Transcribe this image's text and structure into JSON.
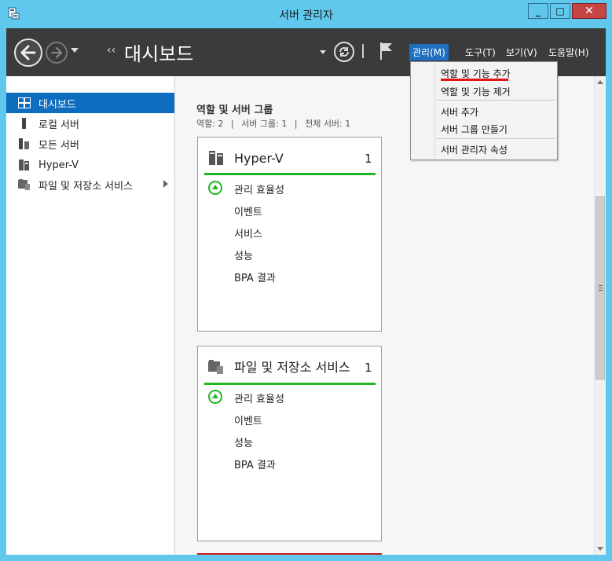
{
  "window": {
    "title": "서버 관리자",
    "minimize": "_",
    "maximize": "□",
    "close": "✕"
  },
  "header": {
    "breadcrumb_arrows": "‹‹",
    "title": "대시보드",
    "menus": [
      "관리(M)",
      "도구(T)",
      "보기(V)",
      "도움말(H)"
    ]
  },
  "sidebar": {
    "items": [
      {
        "label": "대시보드",
        "icon": "dashboard-icon"
      },
      {
        "label": "로컬 서버",
        "icon": "local-server-icon"
      },
      {
        "label": "모든 서버",
        "icon": "all-servers-icon"
      },
      {
        "label": "Hyper-V",
        "icon": "hyperv-icon"
      },
      {
        "label": "파일 및 저장소 서비스",
        "icon": "file-storage-icon"
      }
    ]
  },
  "main": {
    "section_title": "역할 및 서버 그룹",
    "stats": [
      "역할: 2",
      "|",
      "서버 그룹: 1",
      "|",
      "전체 서버: 1"
    ],
    "tiles": [
      {
        "name": "Hyper-V",
        "count": "1",
        "rows": [
          "관리 효율성",
          "이벤트",
          "서비스",
          "성능",
          "BPA 결과"
        ]
      },
      {
        "name": "파일 및 저장소 서비스",
        "count": "1",
        "rows": [
          "관리 효율성",
          "이벤트",
          "성능",
          "BPA 결과"
        ]
      }
    ]
  },
  "dropdown": {
    "items": [
      "역할 및 기능 추가",
      "역할 및 기능 제거",
      "서버 추가",
      "서버 그룹 만들기",
      "서버 관리자 속성"
    ]
  },
  "colors": {
    "titlebar": "#5fc8ec",
    "header": "#3b3b3b",
    "active_accent": "#0f6dbf",
    "status_green": "#20b820",
    "highlight_red": "#e01818"
  }
}
